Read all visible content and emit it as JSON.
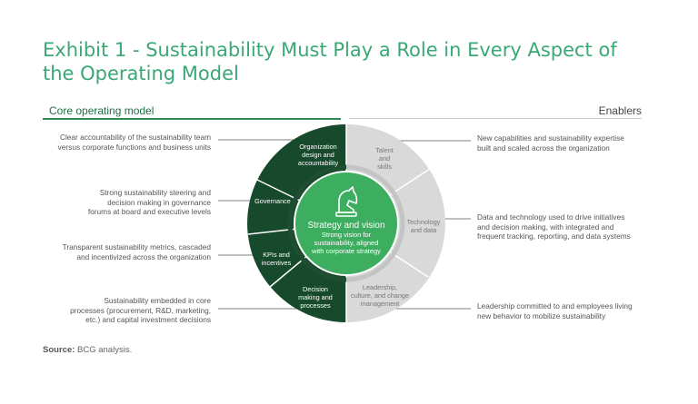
{
  "title": "Exhibit 1 - Sustainability Must Play a Role in Every Aspect of the Operating Model",
  "core_heading": "Core operating model",
  "enablers_heading": "Enablers",
  "center": {
    "title": "Strategy and vision",
    "subtitle": [
      "Strong vision for",
      "sustainability, aligned",
      "with corporate strategy"
    ],
    "icon": "chess-knight-icon"
  },
  "core_segments": [
    {
      "lines": [
        "Organization",
        "design and",
        "accountability"
      ]
    },
    {
      "lines": [
        "Governance"
      ]
    },
    {
      "lines": [
        "KPIs and",
        "incentives"
      ]
    },
    {
      "lines": [
        "Decision",
        "making and",
        "processes"
      ]
    }
  ],
  "enabler_segments": [
    {
      "lines": [
        "Talent",
        "and",
        "skills"
      ]
    },
    {
      "lines": [
        "Technology",
        "and data"
      ]
    },
    {
      "lines": [
        "Leadership,",
        "culture, and change",
        "management"
      ]
    }
  ],
  "left_notes": [
    {
      "lines": [
        "Clear accountability of the sustainability team",
        "versus corporate functions and business units"
      ]
    },
    {
      "lines": [
        "Strong sustainability steering and",
        "decision making in governance",
        "forums at board and executive levels"
      ]
    },
    {
      "lines": [
        "Transparent sustainability metrics, cascaded",
        "and incentivized across the organization"
      ]
    },
    {
      "lines": [
        "Sustainability embedded in core",
        "processes (procurement, R&D, marketing,",
        "etc.) and capital investment decisions"
      ]
    }
  ],
  "right_notes": [
    {
      "lines": [
        "New capabilities and sustainability expertise",
        "built and scaled across the organization"
      ]
    },
    {
      "lines": [
        "Data and technology used to drive initiatives",
        "and decision making, with integrated and",
        "frequent tracking, reporting, and data systems"
      ]
    },
    {
      "lines": [
        "Leadership committed to and employees living",
        "new behavior to mobilize sustainability"
      ]
    }
  ],
  "source": {
    "label": "Source:",
    "text": "BCG analysis."
  },
  "colors": {
    "title": "#3aa876",
    "core_dark": "#174a2c",
    "enabler_light": "#d9d9d9",
    "center_green": "#3dae5f",
    "inner_ring_dark": "#1e4d31",
    "inner_ring_light": "#c4c4c4"
  }
}
